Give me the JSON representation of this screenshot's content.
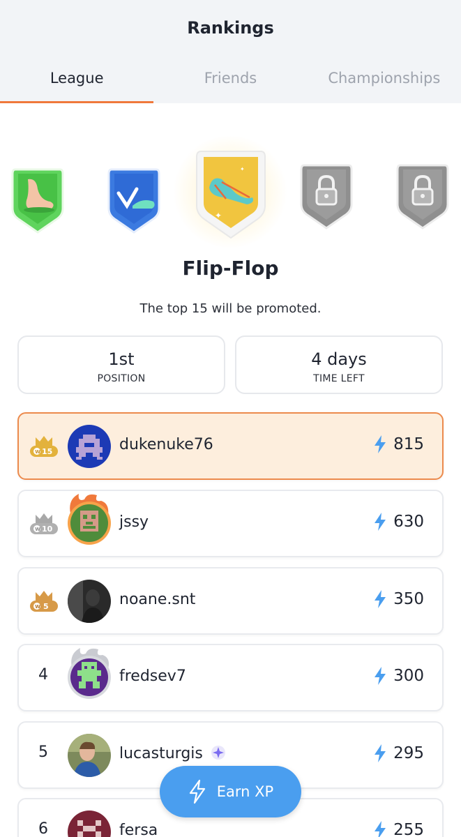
{
  "header": {
    "title": "Rankings",
    "tabs": [
      {
        "label": "League",
        "active": true
      },
      {
        "label": "Friends",
        "active": false
      },
      {
        "label": "Championships",
        "active": false
      }
    ]
  },
  "league": {
    "name": "Flip-Flop",
    "promotion_text": "The top 15 will be promoted.",
    "badges": [
      "foot-badge-icon",
      "slipper-badge-icon",
      "flip-flop-badge-icon",
      "locked-badge-icon",
      "locked-badge-icon"
    ]
  },
  "stats": {
    "position": {
      "value": "1st",
      "label": "POSITION"
    },
    "time_left": {
      "value": "4 days",
      "label": "TIME LEFT"
    }
  },
  "leaderboard": [
    {
      "rank": "1",
      "crown_label": "W15",
      "username": "dukenuke76",
      "xp": "815",
      "highlight": true
    },
    {
      "rank": "2",
      "crown_label": "W10",
      "username": "jssy",
      "xp": "630"
    },
    {
      "rank": "3",
      "crown_label": "W5",
      "username": "noane.snt",
      "xp": "350"
    },
    {
      "rank": "4",
      "username": "fredsev7",
      "xp": "300"
    },
    {
      "rank": "5",
      "username": "lucasturgis",
      "xp": "295",
      "premium": true
    },
    {
      "rank": "6",
      "username": "fersa",
      "xp": "255"
    }
  ],
  "earn_button": {
    "label": "Earn XP"
  },
  "colors": {
    "accent": "#f0793b",
    "xp_blue": "#4a9eef",
    "highlight_bg": "#fdeedd",
    "gold": "#e3b23c",
    "silver": "#a8a8a8",
    "bronze": "#d79a48"
  }
}
